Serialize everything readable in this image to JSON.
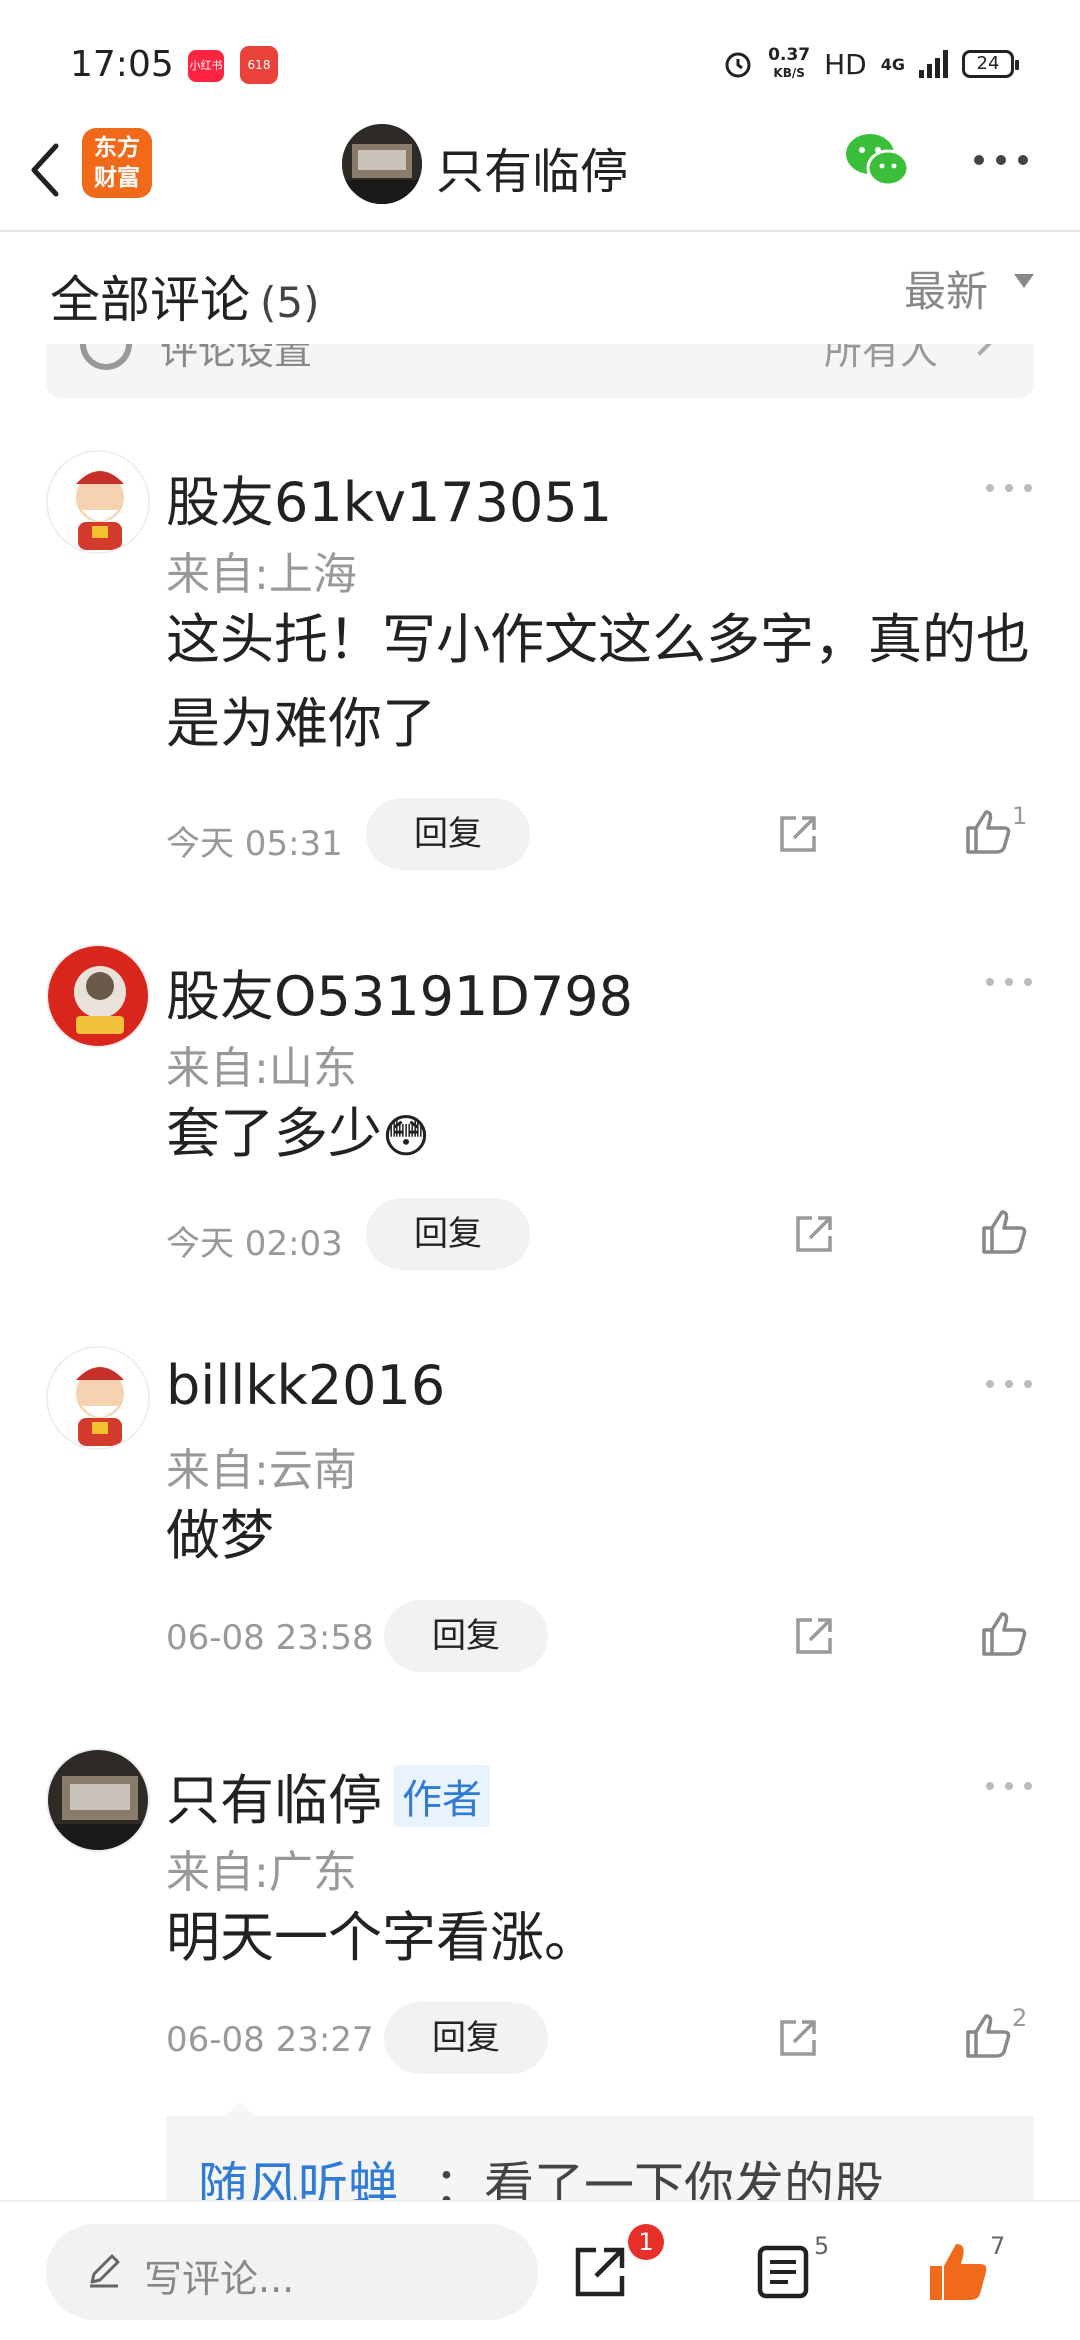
{
  "status_bar": {
    "time": "17:05",
    "app1": "小红书",
    "app2": "618",
    "speed_top": "0.37",
    "speed_unit": "KB/S",
    "hd": "HD",
    "net": "4G",
    "battery": "24"
  },
  "nav": {
    "logo_line1": "东方",
    "logo_line2": "财富",
    "title": "只有临停"
  },
  "header": {
    "label": "全部评论",
    "count": "(5)",
    "sort": "最新"
  },
  "settings": {
    "label": "评论设置",
    "value": "所有人"
  },
  "comments": [
    {
      "name": "股友61kv173051",
      "from": "来自:上海",
      "text": "这头托！写小作文这么多字，真的也是为难你了",
      "time": "今天 05:31",
      "reply": "回复",
      "likes": "1",
      "author": ""
    },
    {
      "name": "股友O53191D798",
      "from": "来自:山东",
      "text": "套了多少",
      "emoji": "😳",
      "time": "今天 02:03",
      "reply": "回复",
      "likes": "",
      "author": ""
    },
    {
      "name": "billkk2016",
      "from": "来自:云南",
      "text": "做梦",
      "time": "06-08 23:58",
      "reply": "回复",
      "likes": "",
      "author": ""
    },
    {
      "name": "只有临停",
      "from": "来自:广东",
      "text": "明天一个字看涨。",
      "time": "06-08 23:27",
      "reply": "回复",
      "likes": "2",
      "author": "作者"
    }
  ],
  "reply_preview": {
    "who": "随风听蝉",
    "text": "：看了一下你发的股"
  },
  "bottom": {
    "placeholder": "写评论...",
    "share_badge": "1",
    "list_count": "5",
    "like_count": "7"
  },
  "colors": {
    "accent": "#f06a1a",
    "link": "#2f7bd6",
    "badge": "#e8302b",
    "wechat": "#3bbf3b"
  }
}
